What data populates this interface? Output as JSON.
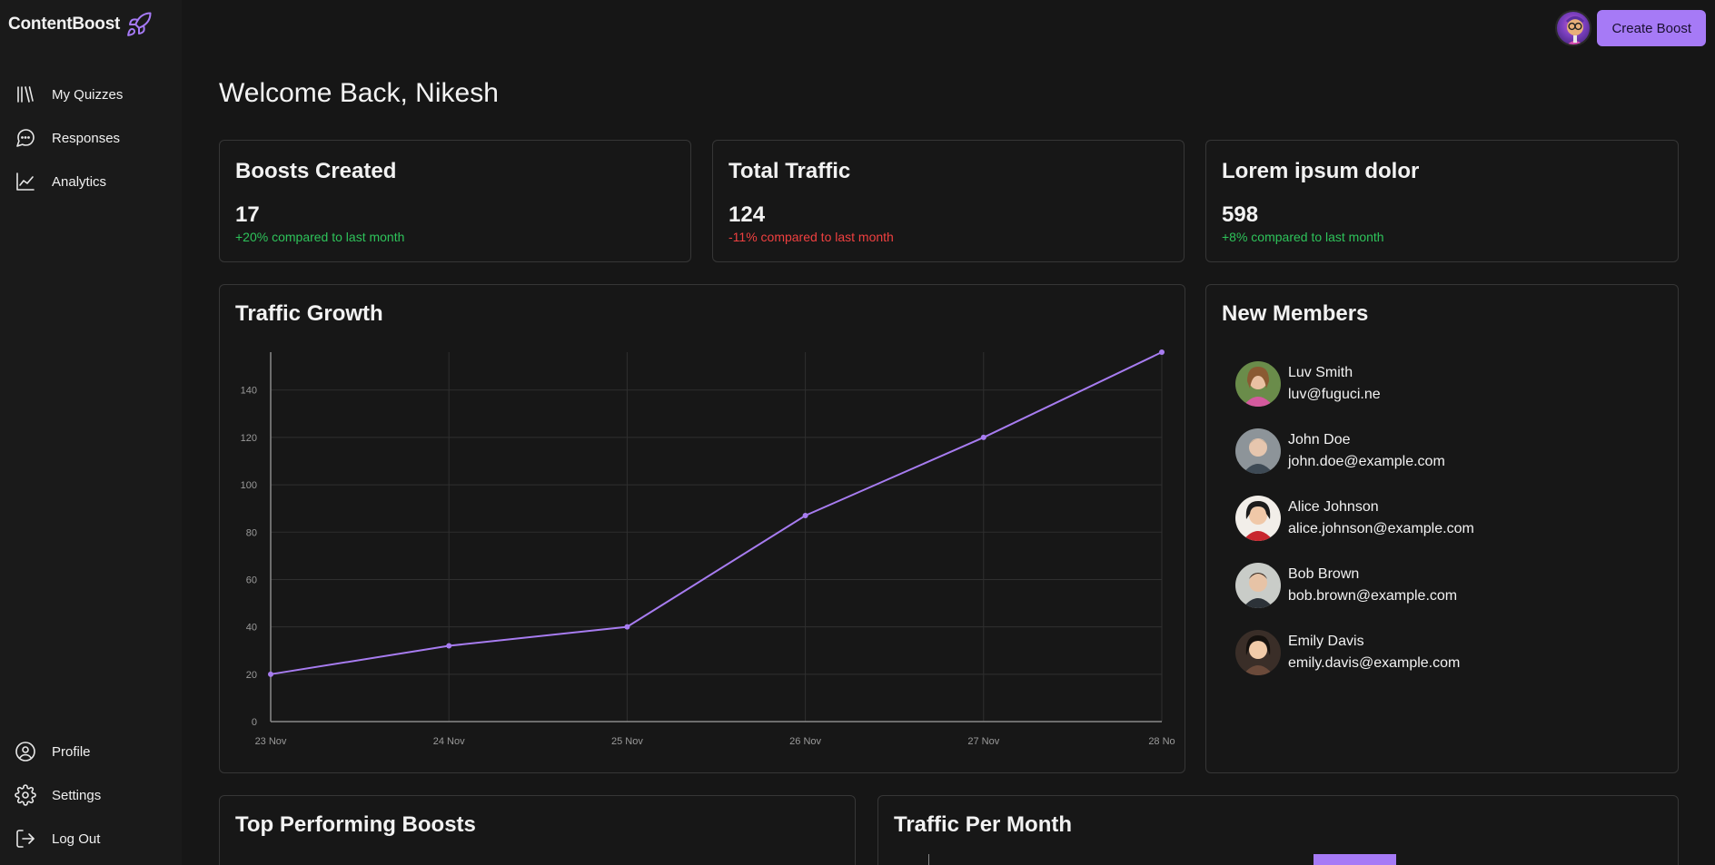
{
  "app": {
    "name": "ContentBoost"
  },
  "sidebar": {
    "top_items": [
      {
        "label": "My Quizzes",
        "icon": "library-icon"
      },
      {
        "label": "Responses",
        "icon": "message-circle-icon"
      },
      {
        "label": "Analytics",
        "icon": "line-chart-icon"
      }
    ],
    "bottom_items": [
      {
        "label": "Profile",
        "icon": "user-circle-icon"
      },
      {
        "label": "Settings",
        "icon": "gear-icon"
      },
      {
        "label": "Log Out",
        "icon": "log-out-icon"
      }
    ]
  },
  "header": {
    "create_button": "Create Boost"
  },
  "welcome": "Welcome Back, Nikesh",
  "stats": [
    {
      "title": "Boosts Created",
      "value": "17",
      "change": "+20% compared to last month",
      "trend": "up"
    },
    {
      "title": "Total Traffic",
      "value": "124",
      "change": "-11% compared to last month",
      "trend": "down"
    },
    {
      "title": "Lorem ipsum dolor",
      "value": "598",
      "change": "+8% compared to last month",
      "trend": "up"
    }
  ],
  "traffic_growth": {
    "title": "Traffic Growth"
  },
  "new_members": {
    "title": "New Members",
    "members": [
      {
        "name": "Luv Smith",
        "email": "luv@fuguci.ne"
      },
      {
        "name": "John Doe",
        "email": "john.doe@example.com"
      },
      {
        "name": "Alice Johnson",
        "email": "alice.johnson@example.com"
      },
      {
        "name": "Bob Brown",
        "email": "bob.brown@example.com"
      },
      {
        "name": "Emily Davis",
        "email": "emily.davis@example.com"
      }
    ]
  },
  "top_performing": {
    "title": "Top Performing Boosts"
  },
  "traffic_per_month": {
    "title": "Traffic Per Month"
  },
  "colors": {
    "accent": "#a67af6",
    "up": "#2ec35a",
    "down": "#f04040",
    "line": "#a77cf0"
  },
  "chart_data": {
    "type": "line",
    "x": [
      "23 Nov",
      "24 Nov",
      "25 Nov",
      "26 Nov",
      "27 Nov",
      "28 No"
    ],
    "series": [
      {
        "values": [
          20,
          32,
          40,
          87,
          120,
          156
        ]
      }
    ],
    "yticks": [
      0,
      20,
      40,
      60,
      80,
      100,
      120,
      140
    ],
    "ylim": [
      0,
      156
    ],
    "grid": true,
    "xlabel": "",
    "ylabel": "",
    "title": ""
  }
}
